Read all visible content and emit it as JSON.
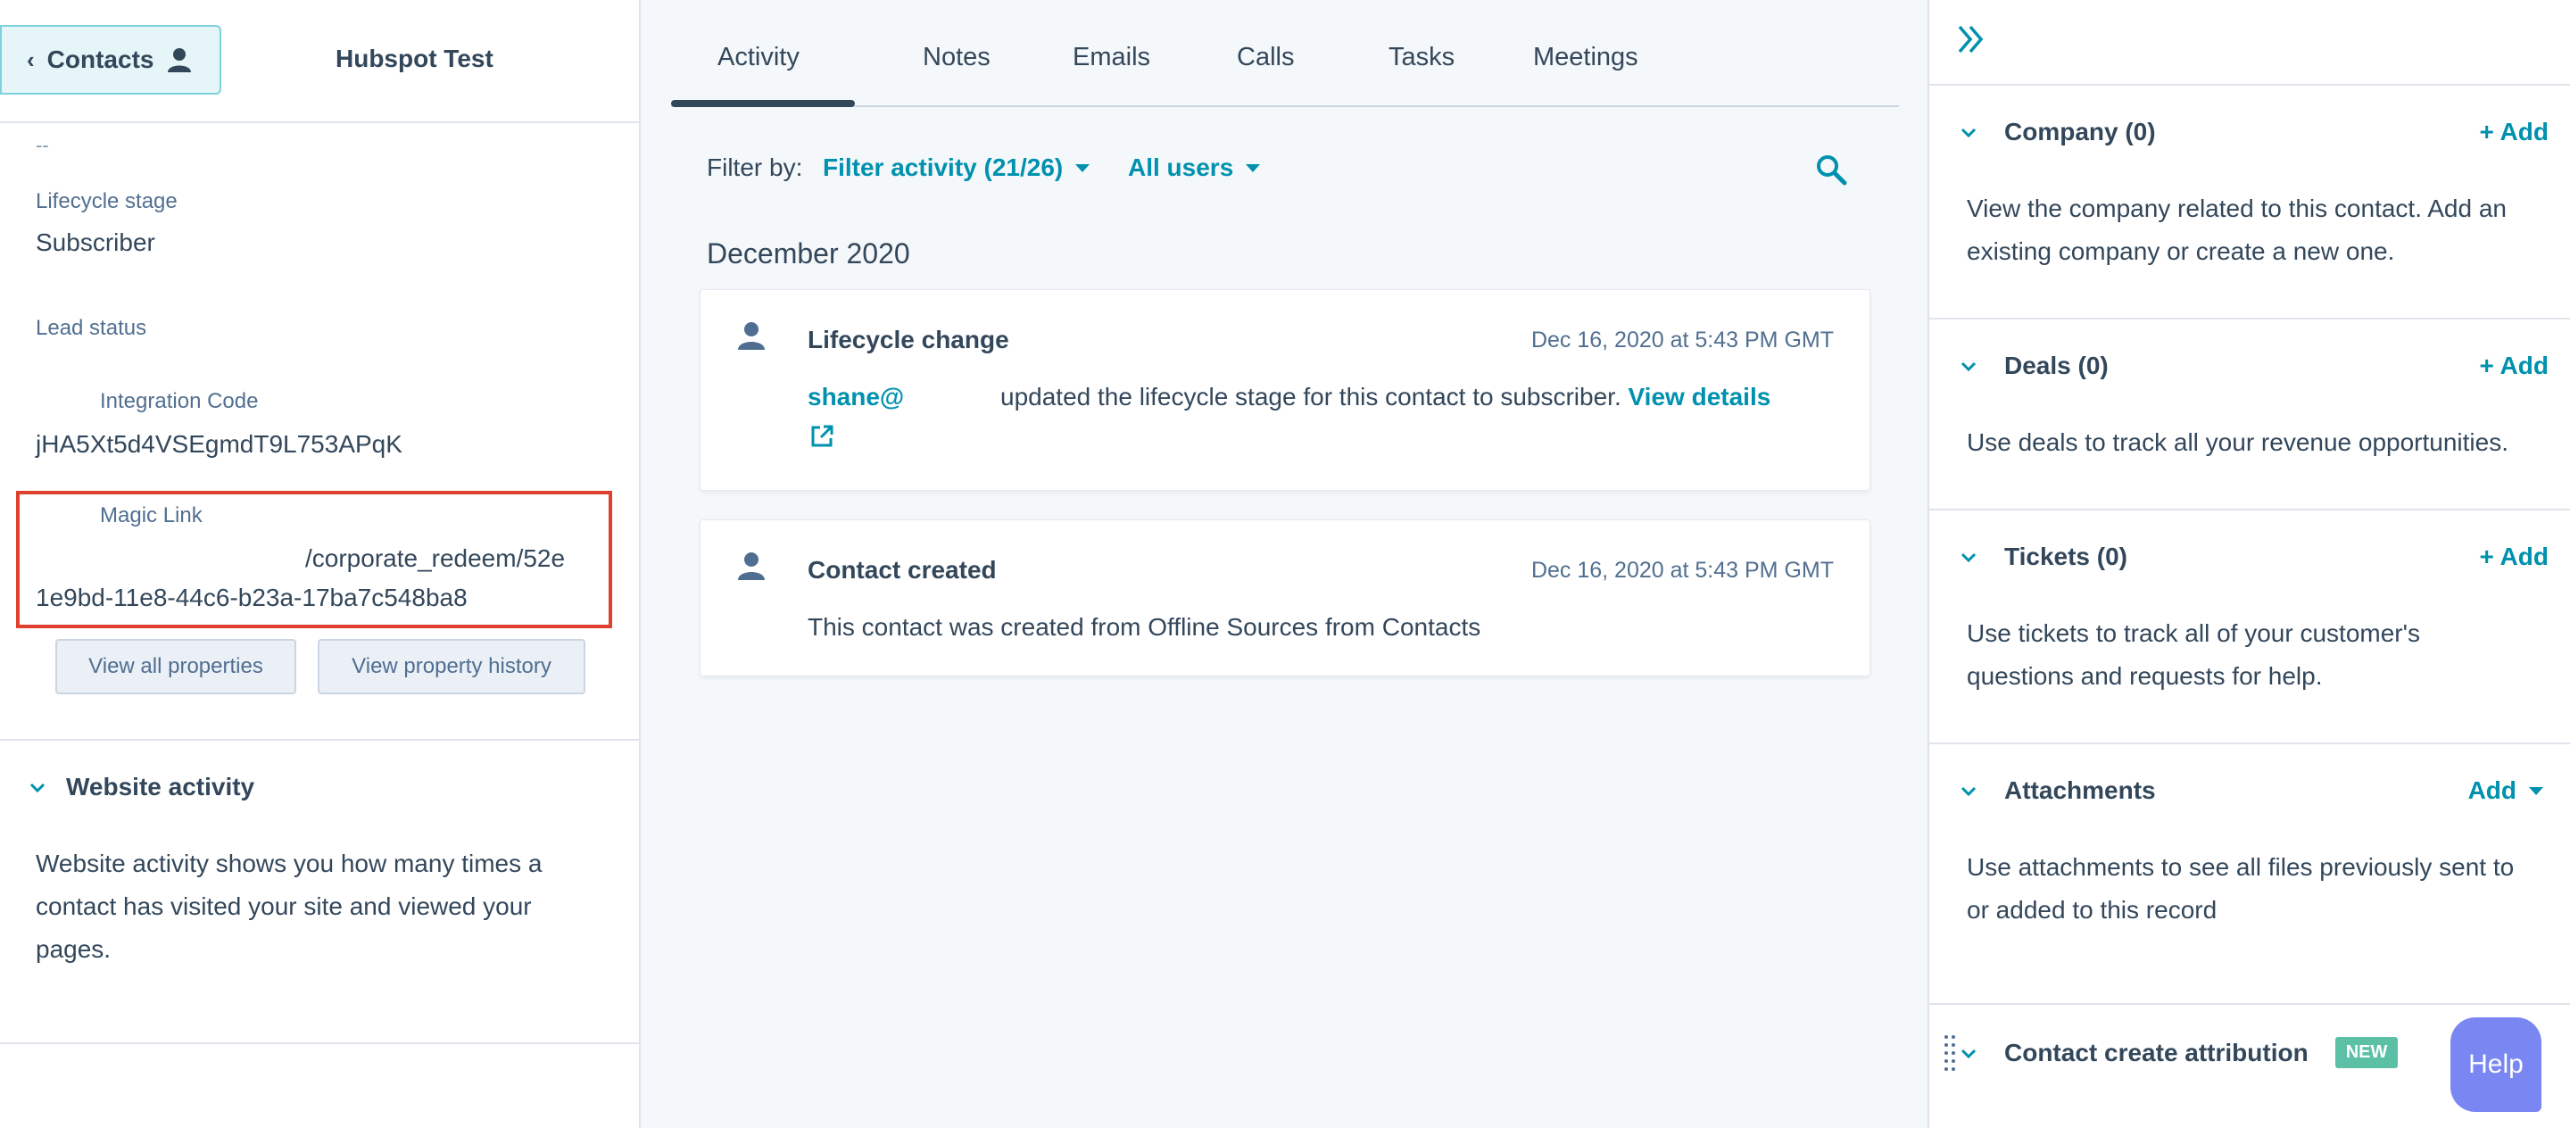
{
  "left_panel": {
    "back_button_label": "Contacts",
    "record_name": "Hubspot Test",
    "empty_value": "--",
    "lifecycle_stage": {
      "label": "Lifecycle stage",
      "value": "Subscriber"
    },
    "lead_status": {
      "label": "Lead status"
    },
    "integration_code": {
      "label": "Integration Code",
      "value": "jHA5Xt5d4VSEgmdT9L753APqK"
    },
    "magic_link": {
      "label": "Magic Link",
      "value_line1": "/corporate_redeem/52e",
      "value_line2": "1e9bd-11e8-44c6-b23a-17ba7c548ba8"
    },
    "view_all_properties": "View all properties",
    "view_property_history": "View property history",
    "website_activity": {
      "title": "Website activity",
      "line1": "Website activity shows you how many times a",
      "line2": "contact has visited your site and viewed your",
      "line3": "pages."
    }
  },
  "middle_panel": {
    "tabs": [
      {
        "label": "Activity",
        "active": true
      },
      {
        "label": "Notes"
      },
      {
        "label": "Emails"
      },
      {
        "label": "Calls"
      },
      {
        "label": "Tasks"
      },
      {
        "label": "Meetings"
      }
    ],
    "filter_by_label": "Filter by:",
    "filter_activity": "Filter activity (21/26)",
    "all_users": "All users",
    "month_header": "December 2020",
    "activities": [
      {
        "title": "Lifecycle change",
        "date": "Dec 16, 2020 at 5:43 PM GMT",
        "user": "shane@",
        "text": "updated the lifecycle stage for this contact to subscriber.",
        "link": "View details"
      },
      {
        "title": "Contact created",
        "date": "Dec 16, 2020 at 5:43 PM GMT",
        "text": "This contact was created from Offline Sources from Contacts"
      }
    ]
  },
  "right_panel": {
    "company": {
      "title": "Company (0)",
      "add": "+ Add",
      "line1": "View the company related to this contact. Add an",
      "line2": "existing company or create a new one."
    },
    "deals": {
      "title": "Deals (0)",
      "add": "+ Add",
      "line1": "Use deals to track all your revenue opportunities."
    },
    "tickets": {
      "title": "Tickets (0)",
      "add": "+ Add",
      "line1": "Use tickets to track all of your customer's",
      "line2": "questions and requests for help."
    },
    "attachments": {
      "title": "Attachments",
      "add": "Add",
      "line1": "Use attachments to see all files previously sent to",
      "line2": "or added to this record"
    },
    "attribution": {
      "title": "Contact create attribution",
      "badge": "NEW"
    }
  },
  "help_button": "Help",
  "colors": {
    "accent": "#0091ae",
    "highlight_box": "#e0412f",
    "help": "#7a87f2",
    "new_badge": "#5bc0a6"
  }
}
